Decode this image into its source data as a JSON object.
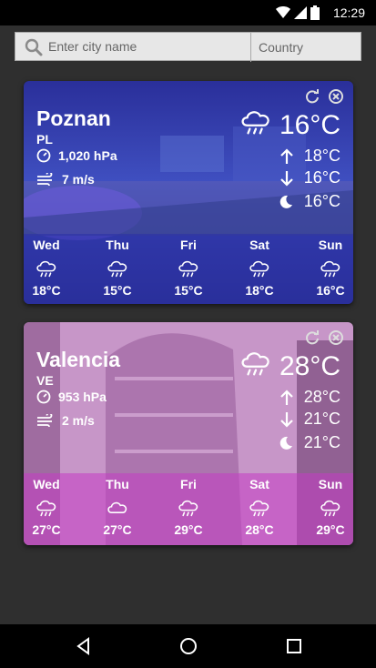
{
  "status_bar": {
    "time": "12:29"
  },
  "search": {
    "city_placeholder": "Enter city name",
    "country_placeholder": "Country"
  },
  "cards": [
    {
      "city": "Poznan",
      "country": "PL",
      "pressure": "1,020 hPa",
      "wind": "7 m/s",
      "temp": "16°C",
      "max": "18°C",
      "min": "16°C",
      "night": "16°C",
      "overlay_color": "#3a3fb8",
      "forecast": [
        {
          "day": "Wed",
          "temp": "18°C",
          "icon": "rain-cloud-icon"
        },
        {
          "day": "Thu",
          "temp": "15°C",
          "icon": "rain-cloud-icon"
        },
        {
          "day": "Fri",
          "temp": "15°C",
          "icon": "rain-cloud-icon"
        },
        {
          "day": "Sat",
          "temp": "18°C",
          "icon": "rain-cloud-icon"
        },
        {
          "day": "Sun",
          "temp": "16°C",
          "icon": "rain-cloud-icon"
        }
      ]
    },
    {
      "city": "Valencia",
      "country": "VE",
      "pressure": "953 hPa",
      "wind": "2 m/s",
      "temp": "28°C",
      "max": "28°C",
      "min": "21°C",
      "night": "21°C",
      "overlay_color": "#d86fd0",
      "forecast": [
        {
          "day": "Wed",
          "temp": "27°C",
          "icon": "rain-cloud-icon"
        },
        {
          "day": "Thu",
          "temp": "27°C",
          "icon": "cloud-icon"
        },
        {
          "day": "Fri",
          "temp": "29°C",
          "icon": "rain-cloud-icon"
        },
        {
          "day": "Sat",
          "temp": "28°C",
          "icon": "rain-cloud-icon"
        },
        {
          "day": "Sun",
          "temp": "29°C",
          "icon": "rain-cloud-icon"
        }
      ]
    }
  ]
}
